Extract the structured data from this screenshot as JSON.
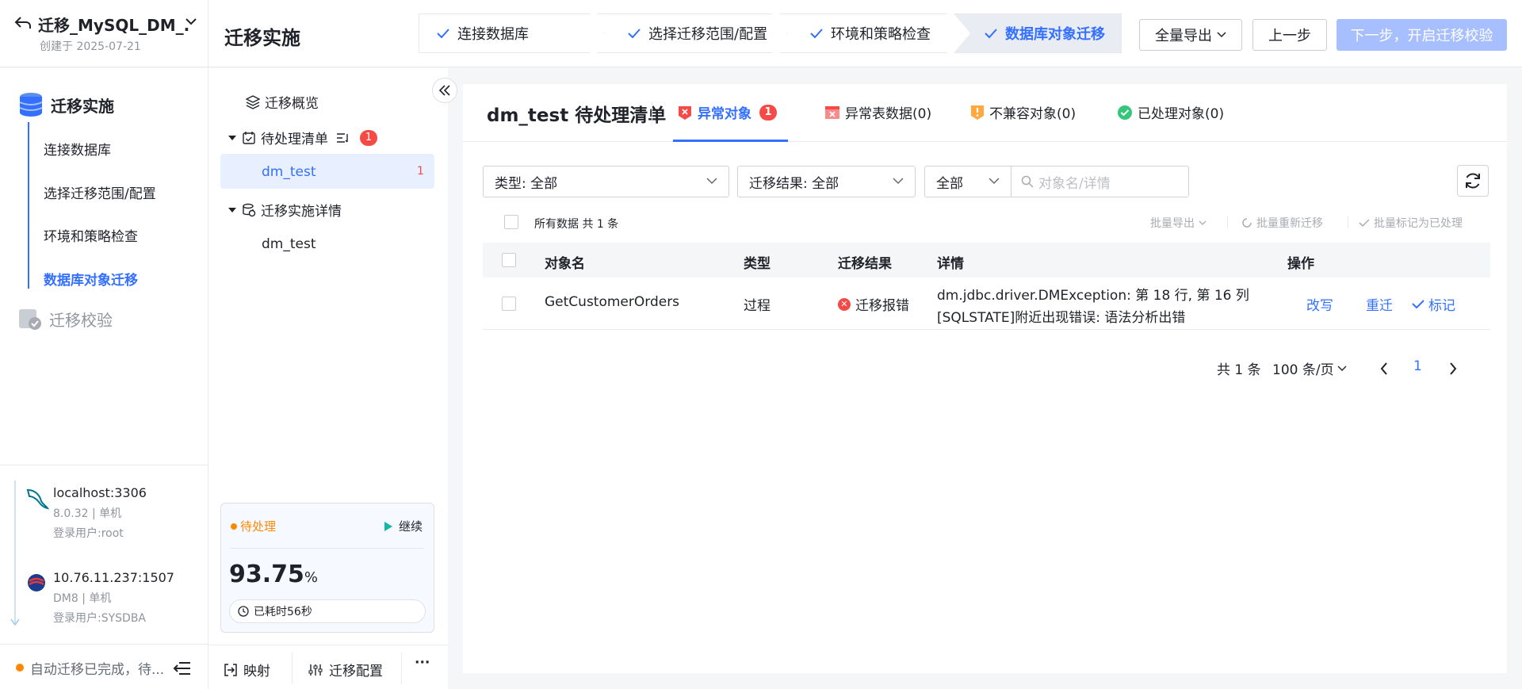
{
  "project": {
    "name": "迁移_MySQL_DM_...",
    "created": "创建于 2025-07-21"
  },
  "header": {
    "title": "迁移实施",
    "steps": [
      "连接数据库",
      "选择迁移范围/配置",
      "环境和策略检查",
      "数据库对象迁移"
    ],
    "export_label": "全量导出",
    "prev_label": "上一步",
    "next_label": "下一步，开启迁移校验"
  },
  "sidebar": {
    "section1": "迁移实施",
    "items": [
      "连接数据库",
      "选择迁移范围/配置",
      "环境和策略检查",
      "数据库对象迁移"
    ],
    "section2": "迁移校验",
    "connections": [
      {
        "host": "localhost:3306",
        "version": "8.0.32 | 单机",
        "user": "登录用户:root"
      },
      {
        "host": "10.76.11.237:1507",
        "version": "DM8 | 单机",
        "user": "登录用户:SYSDBA"
      }
    ],
    "status": "自动迁移已完成，待..."
  },
  "tree": {
    "overview": "迁移概览",
    "pending": "待处理清单",
    "pending_count": "1",
    "pending_child": "dm_test",
    "pending_child_count": "1",
    "details": "迁移实施详情",
    "details_child": "dm_test",
    "card": {
      "status": "待处理",
      "continue": "继续",
      "percent": "93.75",
      "percent_unit": "%",
      "elapsed": "已耗时56秒"
    },
    "footer": {
      "mapping": "映射",
      "config": "迁移配置",
      "more": "···"
    }
  },
  "main": {
    "title": "dm_test 待处理清单",
    "tabs": [
      {
        "label": "异常对象",
        "badge": "1"
      },
      {
        "label": "异常表数据(0)"
      },
      {
        "label": "不兼容对象(0)"
      },
      {
        "label": "已处理对象(0)"
      }
    ],
    "filters": {
      "type": "类型:  全部",
      "result": "迁移结果:  全部",
      "scope": "全部",
      "search_placeholder": "对象名/详情"
    },
    "all_data": "所有数据 共 1 条",
    "bulk": {
      "export": "批量导出",
      "retry": "批量重新迁移",
      "mark": "批量标记为已处理"
    },
    "columns": [
      "对象名",
      "类型",
      "迁移结果",
      "详情",
      "操作"
    ],
    "rows": [
      {
        "name": "GetCustomerOrders",
        "type": "过程",
        "result": "迁移报错",
        "detail1": "dm.jdbc.driver.DMException: 第 18 行, 第 16 列",
        "detail2": "[SQLSTATE]附近出现错误: 语法分析出错",
        "actions": [
          "改写",
          "重迁",
          "标记"
        ]
      }
    ],
    "pagination": {
      "total": "共 1 条",
      "page_size": "100 条/页",
      "current": "1"
    }
  },
  "colors": {
    "accent": "#3370ff",
    "danger": "#f54a45",
    "warning": "#ff8800"
  }
}
